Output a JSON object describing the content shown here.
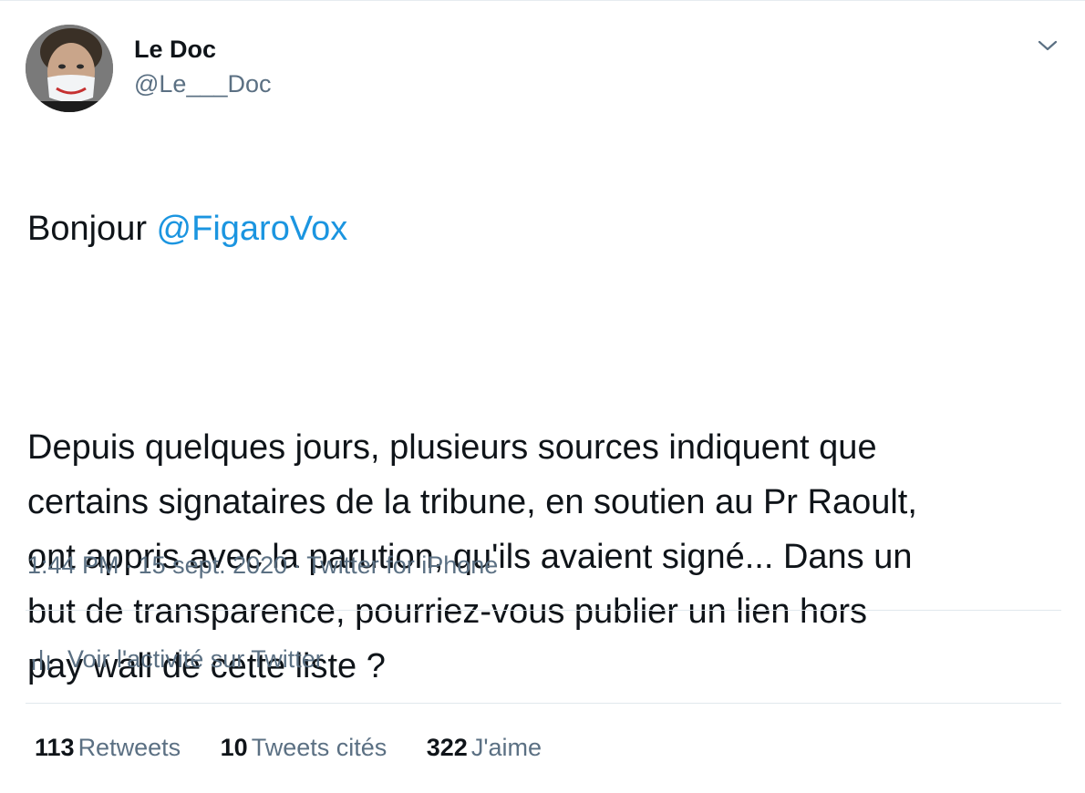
{
  "author": {
    "display_name": "Le Doc",
    "handle": "@Le___Doc"
  },
  "tweet": {
    "greeting": "Bonjour ",
    "mention": "@FigaroVox",
    "body": "Depuis quelques jours, plusieurs sources indiquent que\ncertains signataires de la tribune, en soutien au Pr Raoult,\nont appris avec la parution, qu'ils avaient signé... Dans un\nbut de transparence, pourriez-vous publier un lien hors\npay wall de cette liste ?"
  },
  "meta": {
    "time": "1:44 PM",
    "separator": "·",
    "date": "15 sept. 2020",
    "source": "Twitter for iPhone"
  },
  "activity": {
    "label": "Voir l'activité sur Twitter",
    "icon": "bar-chart-icon"
  },
  "stats": {
    "retweets": {
      "count": "113",
      "label": "Retweets"
    },
    "quotes": {
      "count": "10",
      "label": "Tweets cités"
    },
    "likes": {
      "count": "322",
      "label": "J'aime"
    }
  },
  "colors": {
    "text": "#0f1419",
    "secondary": "#5b7083",
    "link": "#1b95e0",
    "divider": "#e1e8ed"
  }
}
